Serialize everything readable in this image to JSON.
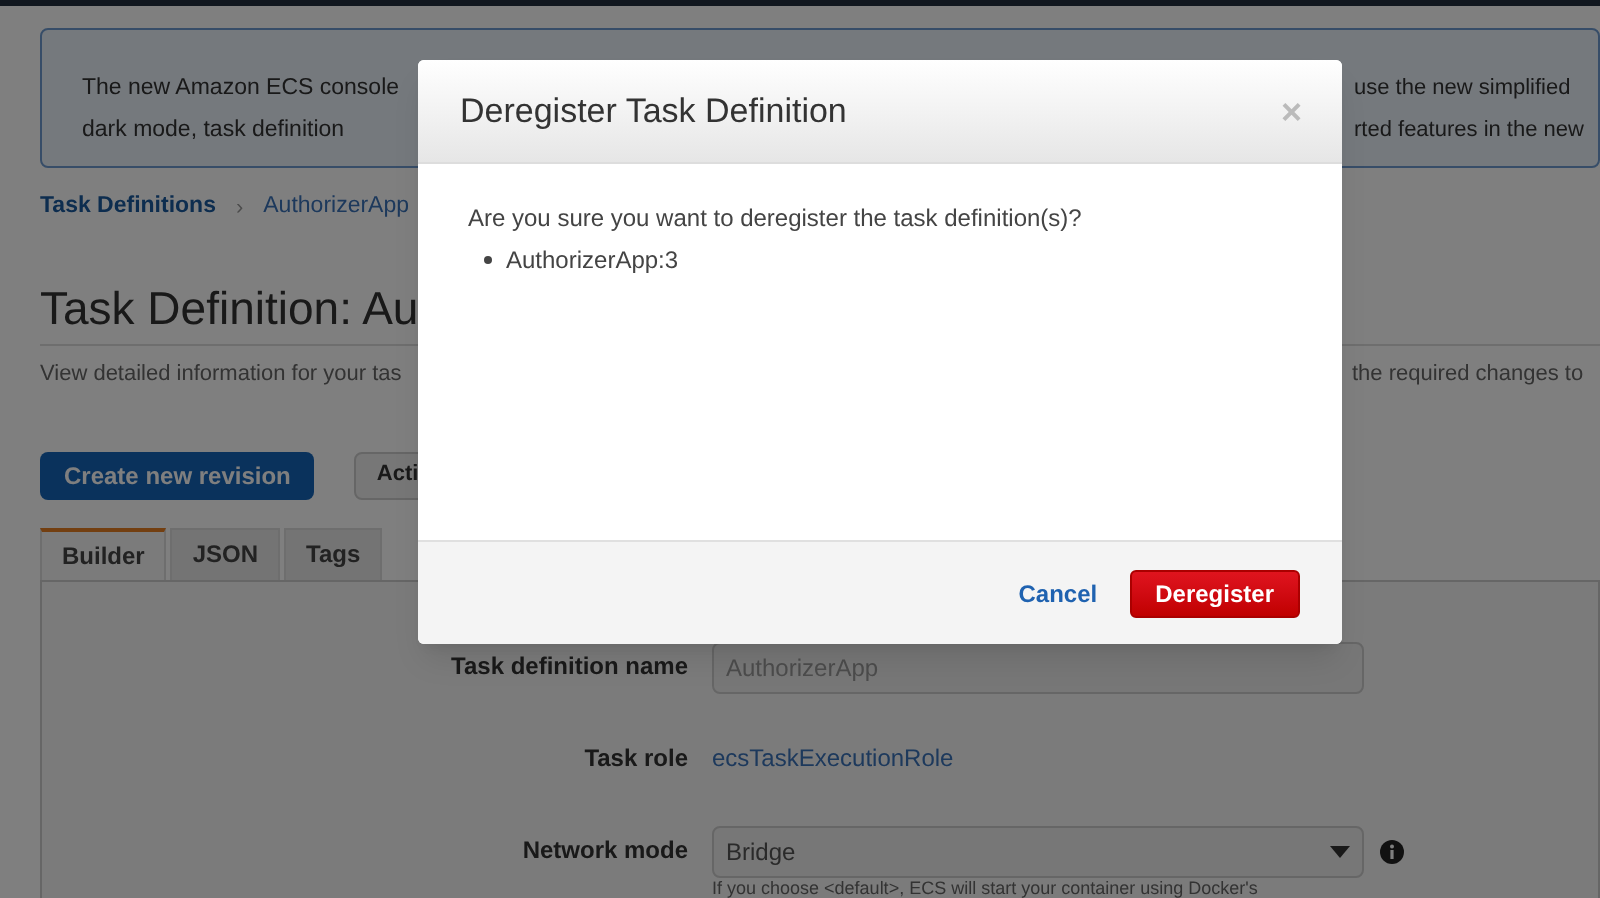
{
  "banner": {
    "line_1_start": "The new Amazon ECS console",
    "line_2_start": "dark mode, task definition",
    "line_1_end": "use the new simplified",
    "line_2_end": "rted features in the new"
  },
  "breadcrumb_separator": "›",
  "breadcrumb": [
    {
      "label": "Task Definitions",
      "link": true
    },
    {
      "label": "AuthorizerApp",
      "link": false
    }
  ],
  "page_title": "Task Definition: Au",
  "description_start": "View detailed information for your tas",
  "description_end": "the required changes to",
  "buttons": [
    {
      "label": "Create new revision",
      "kind": "primary"
    },
    {
      "label": "Acti",
      "kind": "secondary"
    }
  ],
  "tabs": [
    {
      "label": "Builder",
      "selected": true
    },
    {
      "label": "JSON",
      "selected": false
    },
    {
      "label": "Tags",
      "selected": false
    }
  ],
  "form": [
    {
      "label": "Task definition name",
      "kind": "input",
      "value": "AuthorizerApp"
    },
    {
      "label": "Task role",
      "kind": "link",
      "value": "ecsTaskExecutionRole"
    },
    {
      "label": "Network mode",
      "kind": "select",
      "value": "Bridge",
      "help": "If you choose <default>, ECS will start your container using Docker's"
    }
  ],
  "modal": {
    "title": "Deregister Task Definition",
    "close": "×",
    "message": "Are you sure you want to deregister the task definition(s)?",
    "items": [
      "AuthorizerApp:3"
    ],
    "buttons": [
      {
        "label": "Cancel",
        "kind": "link"
      },
      {
        "label": "Deregister",
        "kind": "danger"
      }
    ]
  }
}
